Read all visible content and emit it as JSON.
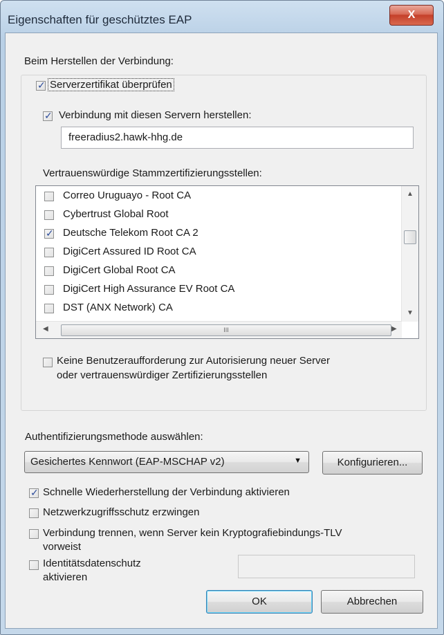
{
  "window": {
    "title": "Eigenschaften für geschütztes EAP",
    "close_label": "X"
  },
  "connection": {
    "heading": "Beim Herstellen der Verbindung:",
    "verify_cert": {
      "label": "Serverzertifikat überprüfen",
      "checked": true
    },
    "connect_servers": {
      "label": "Verbindung mit diesen Servern herstellen:",
      "checked": true
    },
    "server_value": "freeradius2.hawk-hhg.de",
    "ca_heading": "Vertrauenswürdige Stammzertifizierungsstellen:",
    "ca_list": [
      {
        "label": "Correo Uruguayo - Root CA",
        "checked": false
      },
      {
        "label": "Cybertrust Global Root",
        "checked": false
      },
      {
        "label": "Deutsche Telekom Root CA 2",
        "checked": true
      },
      {
        "label": "DigiCert Assured ID Root CA",
        "checked": false
      },
      {
        "label": "DigiCert Global Root CA",
        "checked": false
      },
      {
        "label": "DigiCert High Assurance EV Root CA",
        "checked": false
      },
      {
        "label": "DST (ANX Network) CA",
        "checked": false
      }
    ],
    "no_prompt": {
      "line1": "Keine Benutzeraufforderung zur Autorisierung neuer Server",
      "line2": "oder vertrauenswürdiger Zertifizierungsstellen",
      "checked": false
    }
  },
  "auth": {
    "heading": "Authentifizierungsmethode auswählen:",
    "method_value": "Gesichertes Kennwort (EAP-MSCHAP v2)",
    "configure_label": "Konfigurieren..."
  },
  "options": {
    "fast_reconnect": {
      "label": "Schnelle Wiederherstellung der Verbindung aktivieren",
      "checked": true
    },
    "nap": {
      "label": "Netzwerkzugriffsschutz erzwingen",
      "checked": false
    },
    "disconnect": {
      "line1": "Verbindung trennen, wenn Server kein Kryptografiebindungs-TLV",
      "line2": "vorweist",
      "checked": false
    },
    "identity_privacy": {
      "line1": "Identitätsdatenschutz",
      "line2": "aktivieren",
      "checked": false
    }
  },
  "footer": {
    "ok_label": "OK",
    "cancel_label": "Abbrechen"
  },
  "icons": {
    "check": "✓",
    "scroll_up": "▲",
    "scroll_down": "▼",
    "scroll_left": "◀",
    "scroll_right": "▶",
    "combo_drop": "▼",
    "thumb_grip": "III"
  }
}
